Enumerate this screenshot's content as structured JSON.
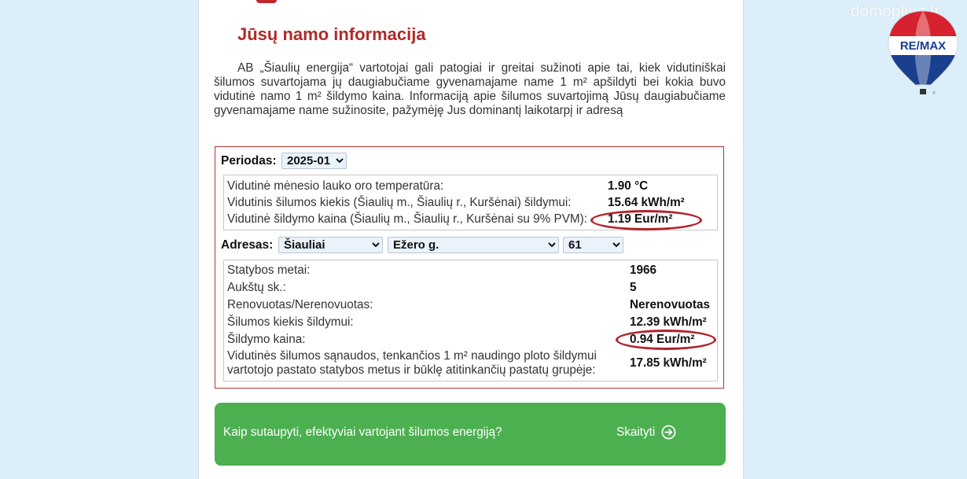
{
  "header": {
    "title": "Jūsų namo informacija",
    "intro": "AB „Šiaulių energija“ vartotojai gali patogiai ir greitai sužinoti apie tai, kiek vidutiniškai šilumos suvartojama jų daugiabučiame gyvenamajame name 1 m² apšildyti bei kokia buvo vidutinė namo 1 m² šildymo kaina. Informaciją apie šilumos suvartojimą Jūsų daugiabučiame gyvenamajame name sužinosite, pažymėję Jus dominantį laikotarpį ir adresą"
  },
  "period": {
    "label": "Periodas:",
    "selected": "2025-01"
  },
  "city_stats": [
    {
      "label": "Vidutinė mėnesio lauko oro temperatūra:",
      "value": "1.90 °C"
    },
    {
      "label": "Vidutinis šilumos kiekis (Šiaulių m., Šiaulių r., Kuršėnai) šildymui:",
      "value": "15.64 kWh/m²"
    },
    {
      "label": "Vidutinė šildymo kaina (Šiaulių m., Šiaulių r., Kuršėnai su 9% PVM):",
      "value": "1.19 Eur/m²"
    }
  ],
  "address": {
    "label": "Adresas:",
    "city": "Šiauliai",
    "street": "Ežero g.",
    "number": "61"
  },
  "building_stats": [
    {
      "label": "Statybos metai:",
      "value": "1966"
    },
    {
      "label": "Aukštų sk.:",
      "value": "5"
    },
    {
      "label": "Renovuotas/Nerenovuotas:",
      "value": "Nerenovuotas"
    },
    {
      "label": "Šilumos kiekis šildymui:",
      "value": "12.39 kWh/m²"
    },
    {
      "label": "Šildymo kaina:",
      "value": "0.94 Eur/m²"
    },
    {
      "label_line1": "Vidutinės šilumos sąnaudos, tenkančios 1 m² naudingo ploto šildymui",
      "label_line2": "vartotojo pastato statybos metus ir būklę atitinkančių pastatų grupėje:",
      "value": "17.85 kWh/m²"
    }
  ],
  "banner": {
    "text": "Kaip sutaupyti, efektyviai vartojant šilumos energiją?",
    "link": "Skaityti",
    "icon": "arrow-circle-right-icon"
  },
  "watermark": {
    "text": "domoplius.lt"
  },
  "brand": {
    "logo_text": "RE/MAX",
    "accent": "#b02a2a",
    "green": "#4caf50"
  }
}
